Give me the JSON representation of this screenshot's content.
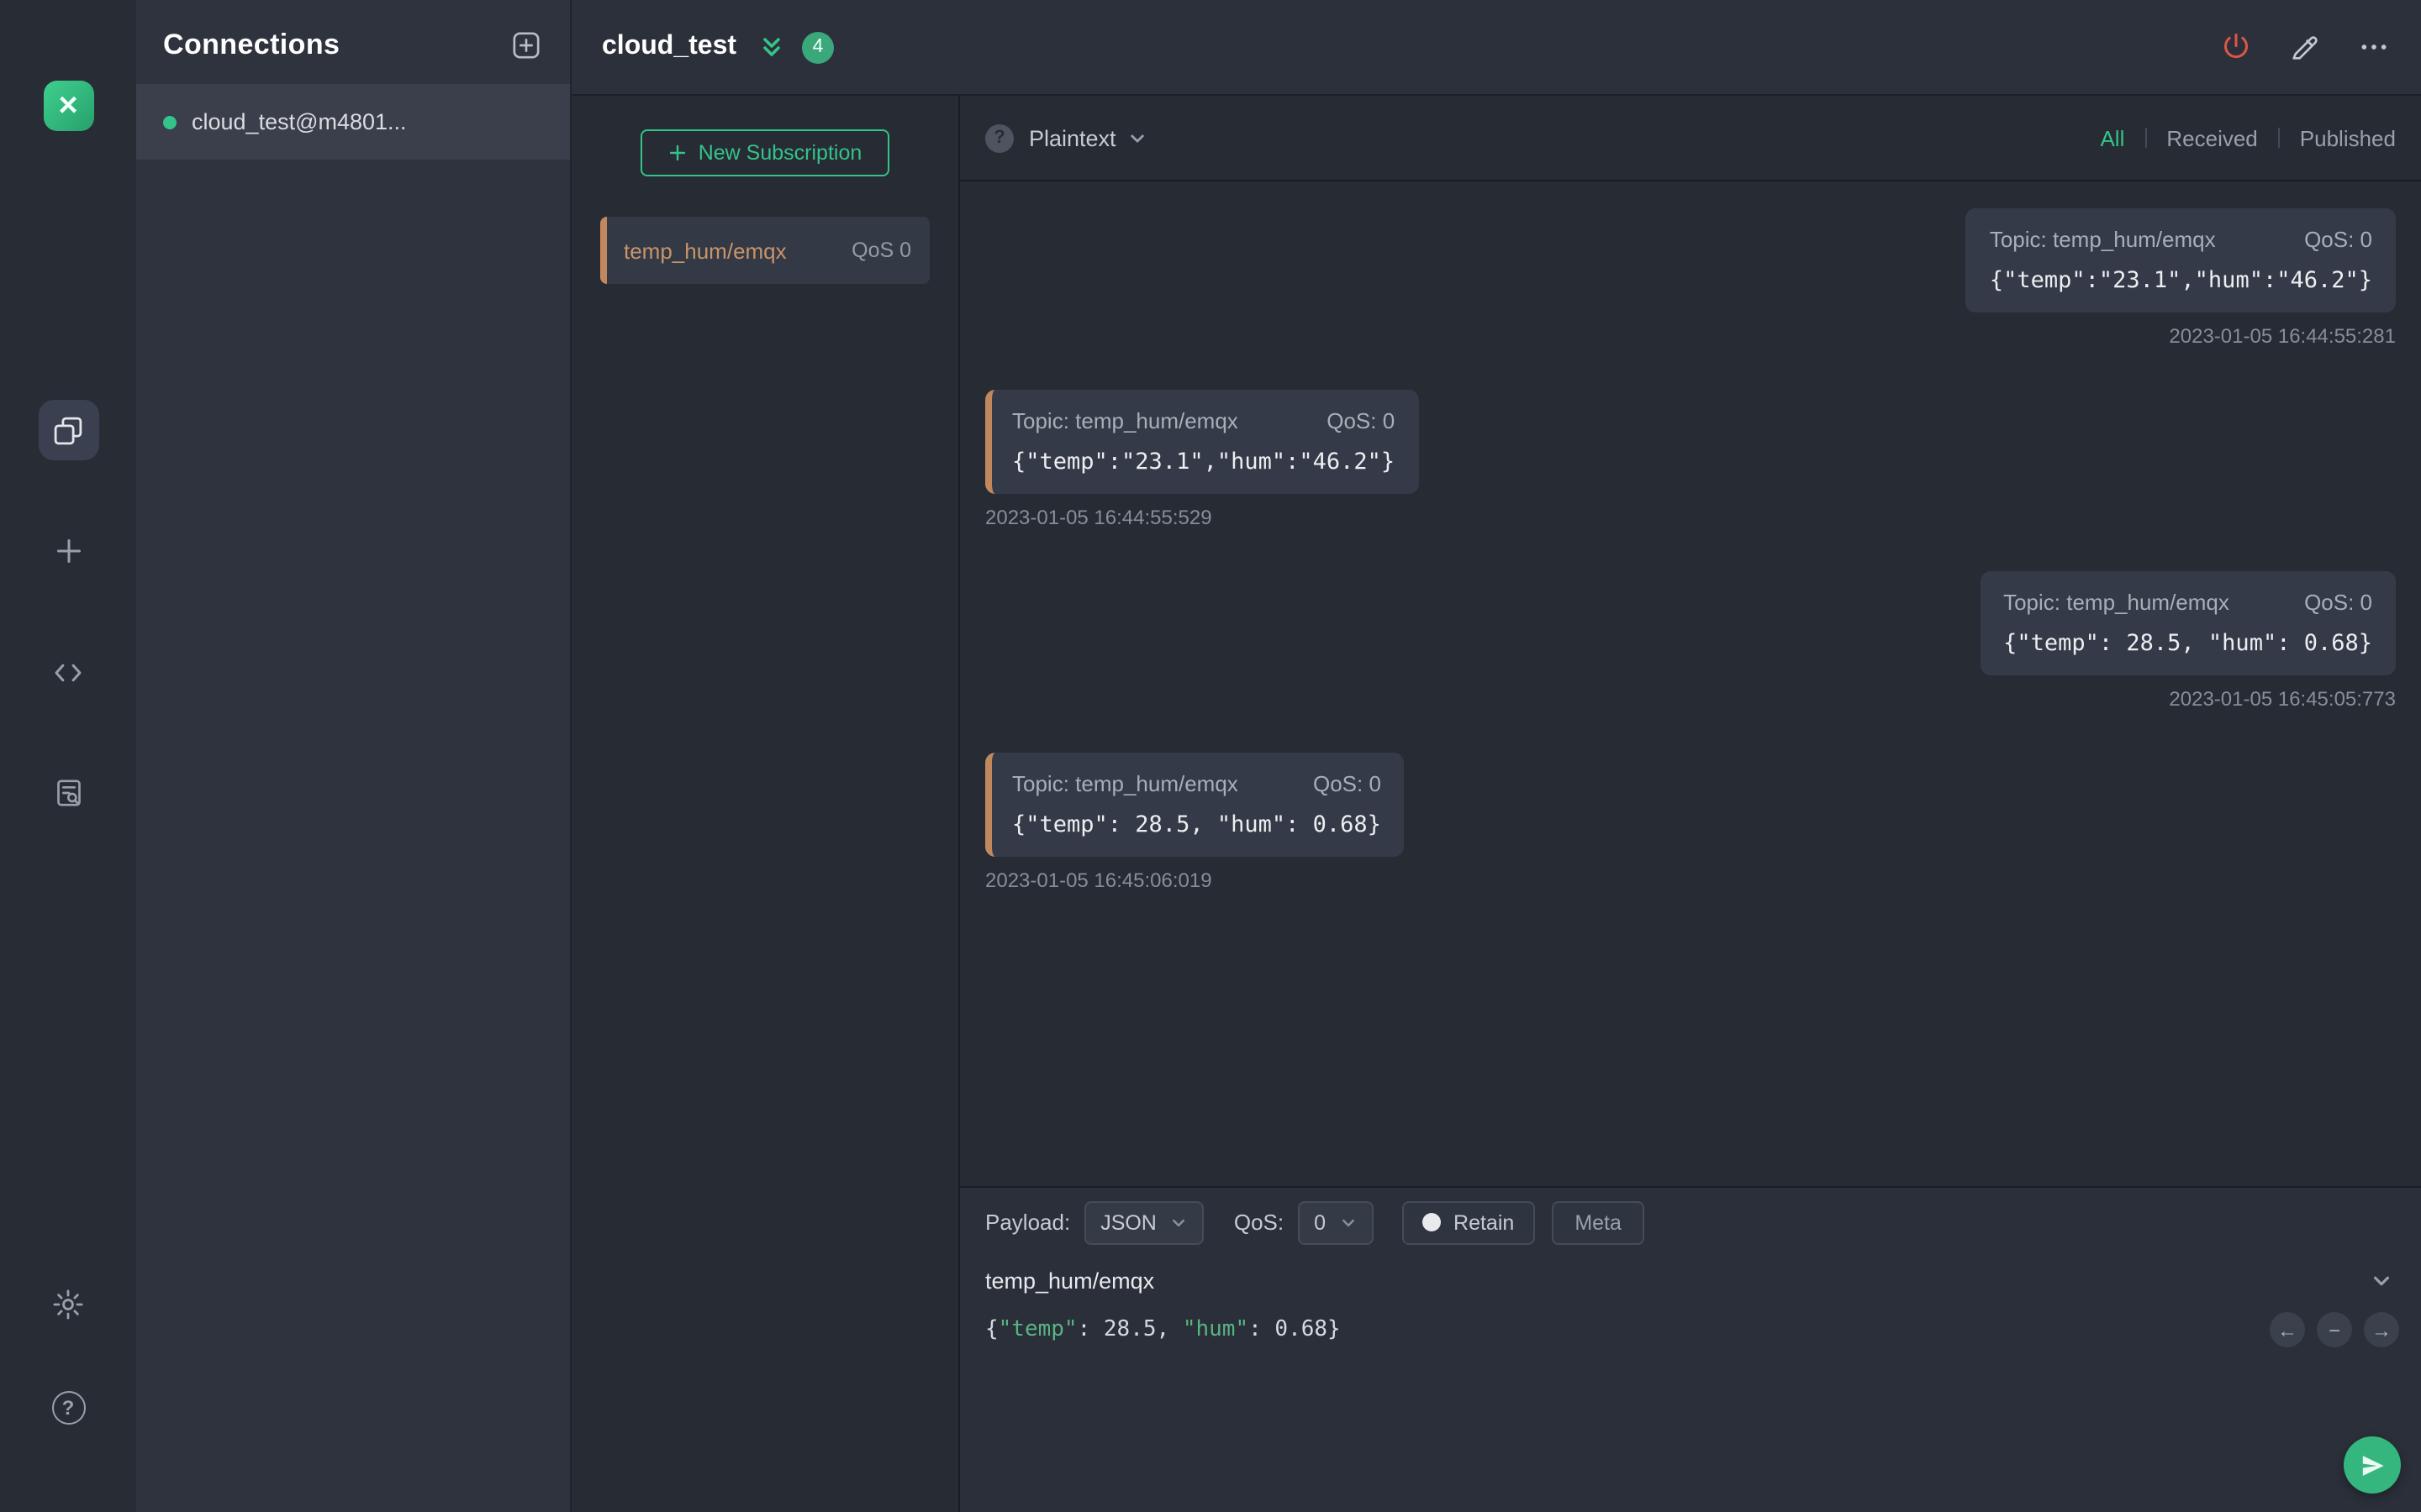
{
  "connections_panel": {
    "title": "Connections",
    "items": [
      {
        "label": "cloud_test@m4801...",
        "connected": true
      }
    ]
  },
  "header": {
    "title": "cloud_test",
    "message_count_badge": "4"
  },
  "subscriptions": {
    "new_subscription_label": "New Subscription",
    "items": [
      {
        "topic": "temp_hum/emqx",
        "qos": "QoS 0"
      }
    ]
  },
  "messages": {
    "format": "Plaintext",
    "filters": {
      "all": "All",
      "received": "Received",
      "published": "Published"
    },
    "items": [
      {
        "direction": "published",
        "topic": "Topic: temp_hum/emqx",
        "qos": "QoS: 0",
        "payload": "{\"temp\":\"23.1\",\"hum\":\"46.2\"}",
        "time": "2023-01-05 16:44:55:281"
      },
      {
        "direction": "received",
        "topic": "Topic: temp_hum/emqx",
        "qos": "QoS: 0",
        "payload": "{\"temp\":\"23.1\",\"hum\":\"46.2\"}",
        "time": "2023-01-05 16:44:55:529"
      },
      {
        "direction": "published",
        "topic": "Topic: temp_hum/emqx",
        "qos": "QoS: 0",
        "payload": "{\"temp\": 28.5, \"hum\": 0.68}",
        "time": "2023-01-05 16:45:05:773"
      },
      {
        "direction": "received",
        "topic": "Topic: temp_hum/emqx",
        "qos": "QoS: 0",
        "payload": "{\"temp\": 28.5, \"hum\": 0.68}",
        "time": "2023-01-05 16:45:06:019"
      }
    ]
  },
  "publish": {
    "payload_label": "Payload:",
    "payload_format": "JSON",
    "qos_label": "QoS:",
    "qos_value": "0",
    "retain_label": "Retain",
    "meta_label": "Meta",
    "topic": "temp_hum/emqx",
    "payload": "{\"temp\": 28.5, \"hum\": 0.68}"
  },
  "icons": {
    "logo_glyph": "×",
    "help_glyph": "?",
    "toolbar_help_glyph": "?",
    "editor_nav_prev": "←",
    "editor_nav_collapse": "−",
    "editor_nav_next": "→"
  },
  "colors": {
    "accent_green": "#34c388",
    "received_accent": "#c1885e",
    "disconnect_red": "#dd5548",
    "connected_dot": "#34c388"
  }
}
